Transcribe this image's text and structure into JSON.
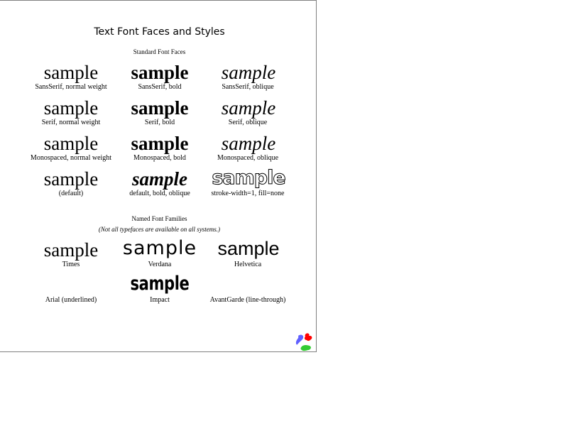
{
  "title": "Text Font Faces and Styles",
  "sections": {
    "standard_heading": "Standard Font Faces",
    "named_heading": "Named Font Families",
    "named_note": "(Not all typefaces are available on all systems.)"
  },
  "sample_text": "sample",
  "standard": [
    {
      "caption": "SansSerif, normal weight"
    },
    {
      "caption": "SansSerif, bold"
    },
    {
      "caption": "SansSerif, oblique"
    },
    {
      "caption": "Serif, normal weight"
    },
    {
      "caption": "Serif, bold"
    },
    {
      "caption": "Serif, oblique"
    },
    {
      "caption": "Monospaced, normal weight"
    },
    {
      "caption": "Monospaced, bold"
    },
    {
      "caption": "Monospaced, oblique"
    },
    {
      "caption": "(default)"
    },
    {
      "caption": "default, bold, oblique"
    },
    {
      "caption": "stroke-width=1, fill=none"
    }
  ],
  "named": [
    {
      "caption": "Times"
    },
    {
      "caption": "Verdana"
    },
    {
      "caption": "Helvetica"
    },
    {
      "caption": "Arial (underlined)"
    },
    {
      "caption": "Impact"
    },
    {
      "caption": "AvantGarde (line-through)"
    }
  ],
  "logo_colors": [
    "#6060ff",
    "#ff0000",
    "#33cc33"
  ]
}
